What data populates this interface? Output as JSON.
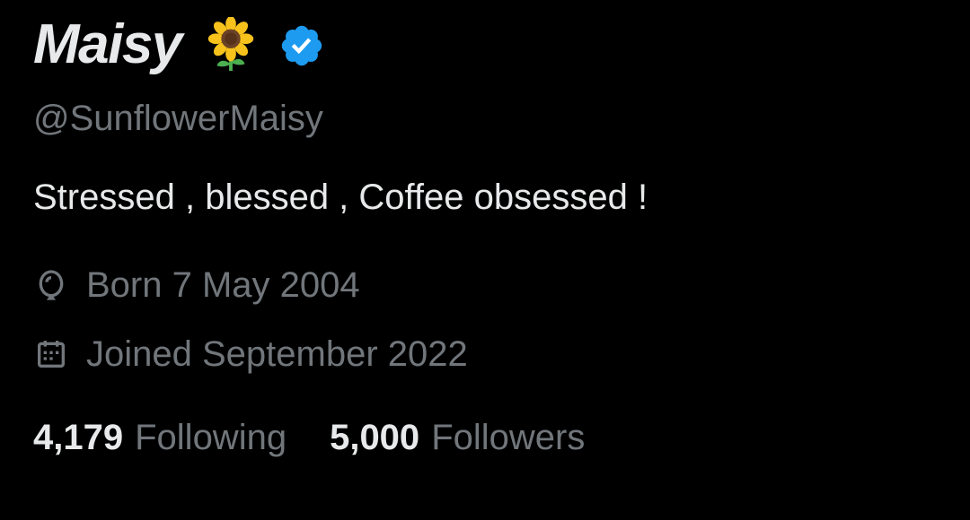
{
  "profile": {
    "display_name": "Maisy",
    "name_emoji_icon": "sunflower-icon",
    "verified_icon": "verified-badge-icon",
    "handle": "@SunflowerMaisy",
    "bio": "Stressed , blessed , Coffee obsessed !",
    "birth_icon": "balloon-icon",
    "birth_text": "Born 7 May 2004",
    "joined_icon": "calendar-icon",
    "joined_text": "Joined September 2022",
    "following_count": "4,179",
    "following_label": "Following",
    "followers_count": "5,000",
    "followers_label": "Followers"
  },
  "colors": {
    "background": "#000000",
    "primary_text": "#e7e9ea",
    "secondary_text": "#71767b",
    "verified_blue": "#1d9bf0",
    "sunflower_petal": "#f7c21b",
    "sunflower_center": "#6b4226",
    "stem_green": "#4caf50"
  }
}
